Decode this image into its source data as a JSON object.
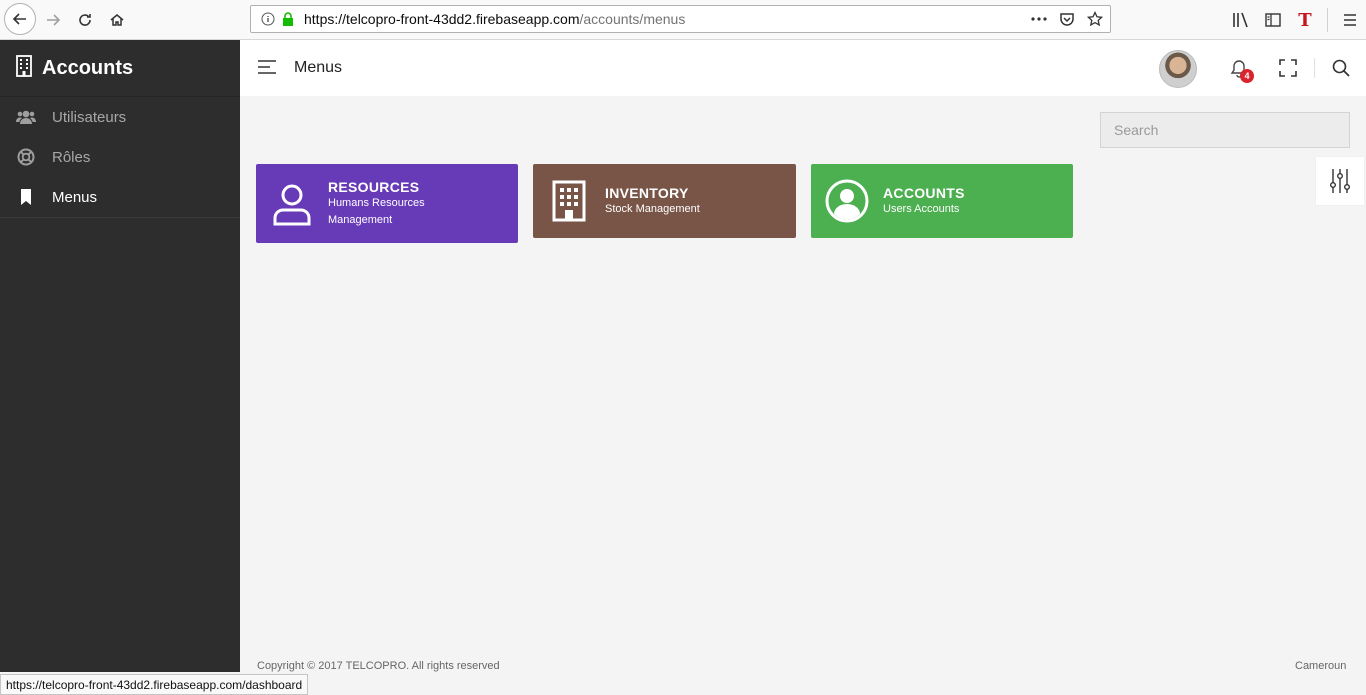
{
  "browser": {
    "url_host": "https://telcopro-front-43dd2.firebaseapp.com",
    "url_path": "/accounts/menus",
    "status_url": "https://telcopro-front-43dd2.firebaseapp.com/dashboard"
  },
  "sidebar": {
    "brand": "Accounts",
    "items": [
      {
        "label": "Utilisateurs",
        "icon": "users-icon"
      },
      {
        "label": "Rôles",
        "icon": "lifebuoy-icon"
      },
      {
        "label": "Menus",
        "icon": "bookmark-icon"
      }
    ]
  },
  "header": {
    "title": "Menus",
    "notification_count": "4"
  },
  "search": {
    "placeholder": "Search"
  },
  "cards": [
    {
      "title": "RESOURCES",
      "subtitle": "Humans Resources Management",
      "color": "#673ab7",
      "icon": "person-outline-icon"
    },
    {
      "title": "INVENTORY",
      "subtitle": "Stock Management",
      "color": "#795548",
      "icon": "building-icon"
    },
    {
      "title": "ACCOUNTS",
      "subtitle": "Users Accounts",
      "color": "#4caf50",
      "icon": "user-circle-icon"
    }
  ],
  "footer": {
    "copyright": "Copyright © 2017 TELCOPRO. All rights reserved",
    "region": "Cameroun"
  }
}
